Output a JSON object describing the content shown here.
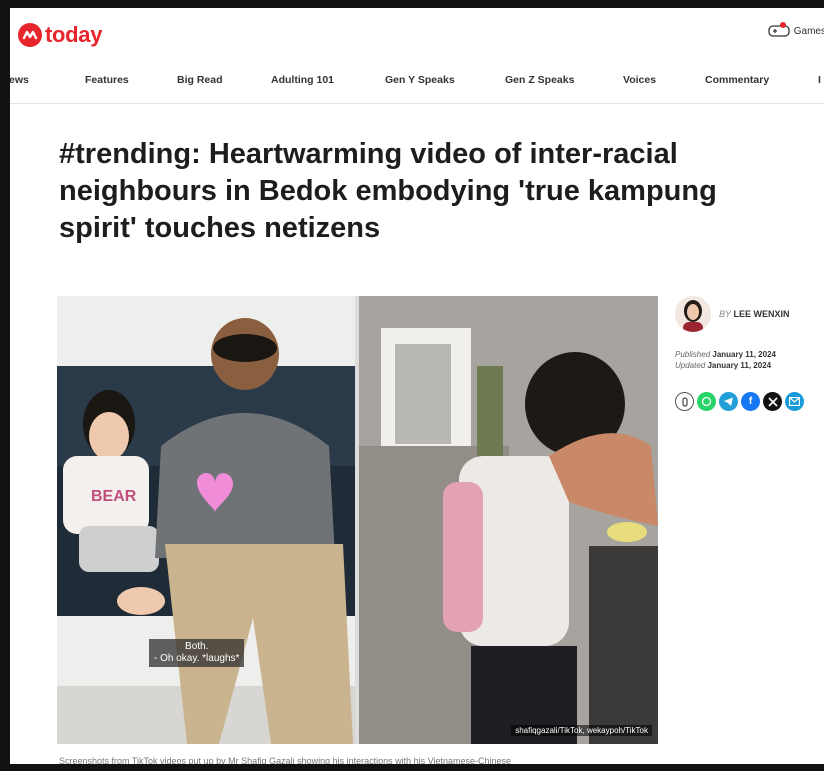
{
  "brand": {
    "name": "today",
    "accent": "#e6262c"
  },
  "header": {
    "games_label": "Games"
  },
  "nav": {
    "items": [
      "ews",
      "Features",
      "Big Read",
      "Adulting 101",
      "Gen Y Speaks",
      "Gen Z Speaks",
      "Voices",
      "Commentary",
      "I"
    ]
  },
  "article": {
    "title": "#trending: Heartwarming video of inter-racial neighbours in Bedok embodying 'true kampung spirit' touches netizens",
    "subtitle_line1": "Both.",
    "subtitle_line2": "- Oh okay. *laughs*",
    "image_credit": "shafiqgazali/TikTok, wekaypoh/TikTok",
    "caption": "Screenshots from TikTok videos put up by Mr Shafiq Gazali showing his interactions with his Vietnamese-Chinese",
    "author_prefix": "BY",
    "author": "LEE WENXIN",
    "published_label": "Published",
    "published_date": "January 11, 2024",
    "updated_label": "Updated",
    "updated_date": "January 11, 2024"
  },
  "share": [
    {
      "name": "copy-link",
      "color": "#ffffff",
      "icon": "link-icon"
    },
    {
      "name": "whatsapp",
      "color": "#25d366",
      "icon": "whatsapp-icon"
    },
    {
      "name": "telegram",
      "color": "#229ed9",
      "icon": "telegram-icon"
    },
    {
      "name": "facebook",
      "color": "#1877f2",
      "icon": "facebook-icon"
    },
    {
      "name": "x",
      "color": "#111111",
      "icon": "x-icon"
    },
    {
      "name": "email",
      "color": "#1a9bd7",
      "icon": "email-icon"
    }
  ]
}
